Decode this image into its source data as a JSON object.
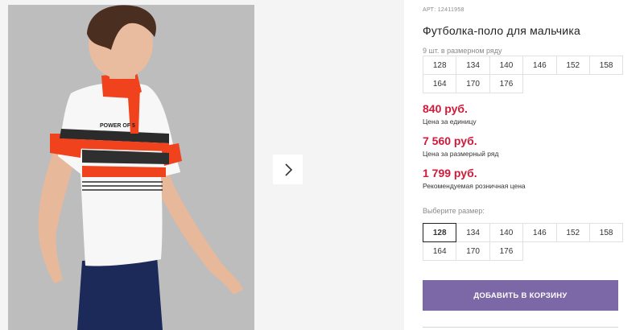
{
  "product": {
    "article": "АРТ: 12411958",
    "title": "Футболка-поло для мальчика",
    "pack_label": "9 шт. в размерном ряду",
    "pack_sizes": [
      "128",
      "134",
      "140",
      "146",
      "152",
      "158",
      "164",
      "170",
      "176"
    ],
    "prices": [
      {
        "value": "840 руб.",
        "note": "Цена за единицу"
      },
      {
        "value": "7 560 руб.",
        "note": "Цена за размерный ряд"
      },
      {
        "value": "1 799 руб.",
        "note": "Рекомендуемая розничная цена"
      }
    ],
    "choose_size_label": "Выберите размер:",
    "select_sizes": [
      "128",
      "134",
      "140",
      "146",
      "152",
      "158",
      "164",
      "170",
      "176"
    ],
    "selected_size": "128",
    "add_to_cart": "ДОБАВИТЬ В КОРЗИНУ",
    "shirt_print": "POWER OF 5"
  },
  "colors": {
    "price": "#d2193a",
    "button": "#7d68a7",
    "accent_stripe": "#f0421c"
  }
}
